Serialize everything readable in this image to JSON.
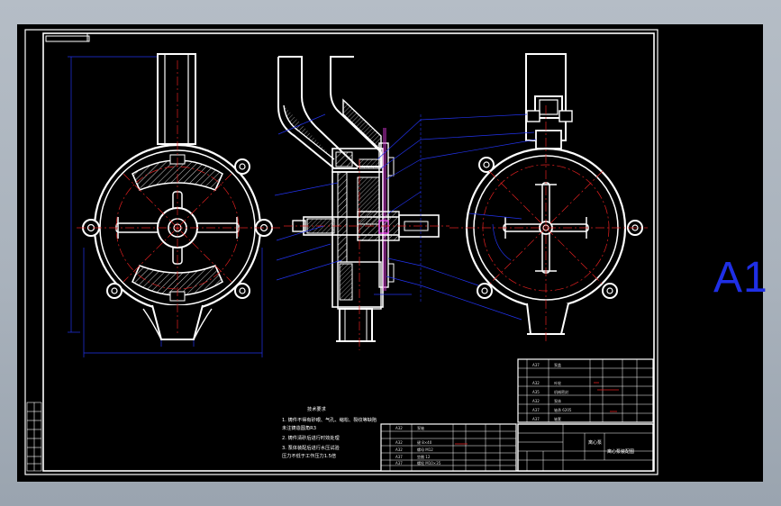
{
  "sheet_label": "A1",
  "technical_requirements": {
    "title": "技术要求",
    "items": [
      "1. 铸件不得有砂眼、气孔、缩松、裂纹等缺陷",
      "   未注铸造圆角R3",
      "2. 铸件清砂后进行时效处理",
      "3. 泵体装配后进行水压试验",
      "   压力不低于工作压力1.5倍"
    ]
  },
  "colors": {
    "background": "#000000",
    "outline": "#ffffff",
    "centerline": "#e02020",
    "dimension": "#2233ee",
    "hatch": "#cfcfcf",
    "sheet_label": "#1f2fe6",
    "window": "#b5bdc6"
  },
  "parts_list_primary": {
    "rows": [
      [
        "",
        "A37",
        "泵盖",
        "",
        "",
        ""
      ],
      [
        "",
        "",
        "",
        "",
        "",
        ""
      ],
      [
        "",
        "A32",
        "叶轮",
        "",
        "",
        ""
      ],
      [
        "",
        "A35",
        "机械密封",
        "",
        "",
        ""
      ],
      [
        "",
        "A32",
        "泵体",
        "",
        "",
        ""
      ],
      [
        "",
        "A37",
        "轴承 6205",
        "",
        "",
        ""
      ],
      [
        "",
        "A37",
        "轴套",
        "",
        "",
        ""
      ]
    ]
  },
  "parts_list_secondary": {
    "rows": [
      [
        "",
        "A32",
        "泵轴",
        "",
        "",
        ""
      ],
      [
        "",
        "",
        "",
        "",
        "",
        ""
      ],
      [
        "",
        "A32",
        "键 8×40",
        "",
        "",
        ""
      ],
      [
        "",
        "A32",
        "螺母 M12",
        "",
        "",
        ""
      ],
      [
        "",
        "A37",
        "垫圈 12",
        "",
        "",
        ""
      ],
      [
        "",
        "A37",
        "螺栓 M10×35",
        "",
        "",
        ""
      ]
    ]
  },
  "title_block": {
    "drawing_title": "离心泵",
    "part_label": "离心泵装配图"
  }
}
